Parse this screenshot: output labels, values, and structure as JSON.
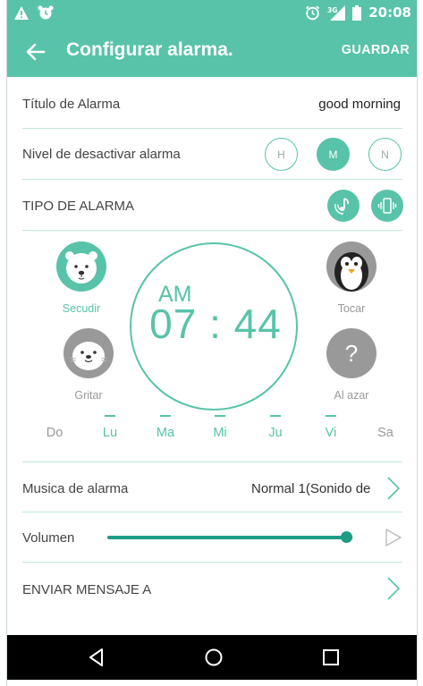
{
  "status_bar": {
    "time": "20:08"
  },
  "app_bar": {
    "title": "Configurar alarma.",
    "save_label": "GUARDAR"
  },
  "title_row": {
    "label": "Título de Alarma",
    "value": "good morning"
  },
  "level_row": {
    "label": "Nivel de desactivar alarma",
    "options": [
      {
        "label": "H",
        "selected": false
      },
      {
        "label": "M",
        "selected": true
      },
      {
        "label": "N",
        "selected": false
      }
    ]
  },
  "type_row": {
    "label": "TIPO DE ALARMA"
  },
  "clock": {
    "ampm": "AM",
    "time": "07 : 44"
  },
  "methods": [
    {
      "name": "Secudir",
      "selected": true,
      "icon": "polar-bear-icon"
    },
    {
      "name": "Tocar",
      "selected": false,
      "icon": "penguin-icon"
    },
    {
      "name": "Gritar",
      "selected": false,
      "icon": "seal-icon"
    },
    {
      "name": "Al azar",
      "selected": false,
      "icon": "question-mark-icon"
    }
  ],
  "days": [
    {
      "label": "Do",
      "on": false
    },
    {
      "label": "Lu",
      "on": true
    },
    {
      "label": "Ma",
      "on": true
    },
    {
      "label": "Mi",
      "on": true
    },
    {
      "label": "Ju",
      "on": true
    },
    {
      "label": "Vi",
      "on": true
    },
    {
      "label": "Sa",
      "on": false
    }
  ],
  "music_row": {
    "label": "Musica de alarma",
    "value": "Normal 1(Sonido de"
  },
  "volume_row": {
    "label": "Volumen",
    "level": 0.97
  },
  "message_row": {
    "label": "ENVIAR MENSAJE A"
  },
  "colors": {
    "accent": "#58c3a8",
    "accent_dark": "#1f9c86"
  }
}
